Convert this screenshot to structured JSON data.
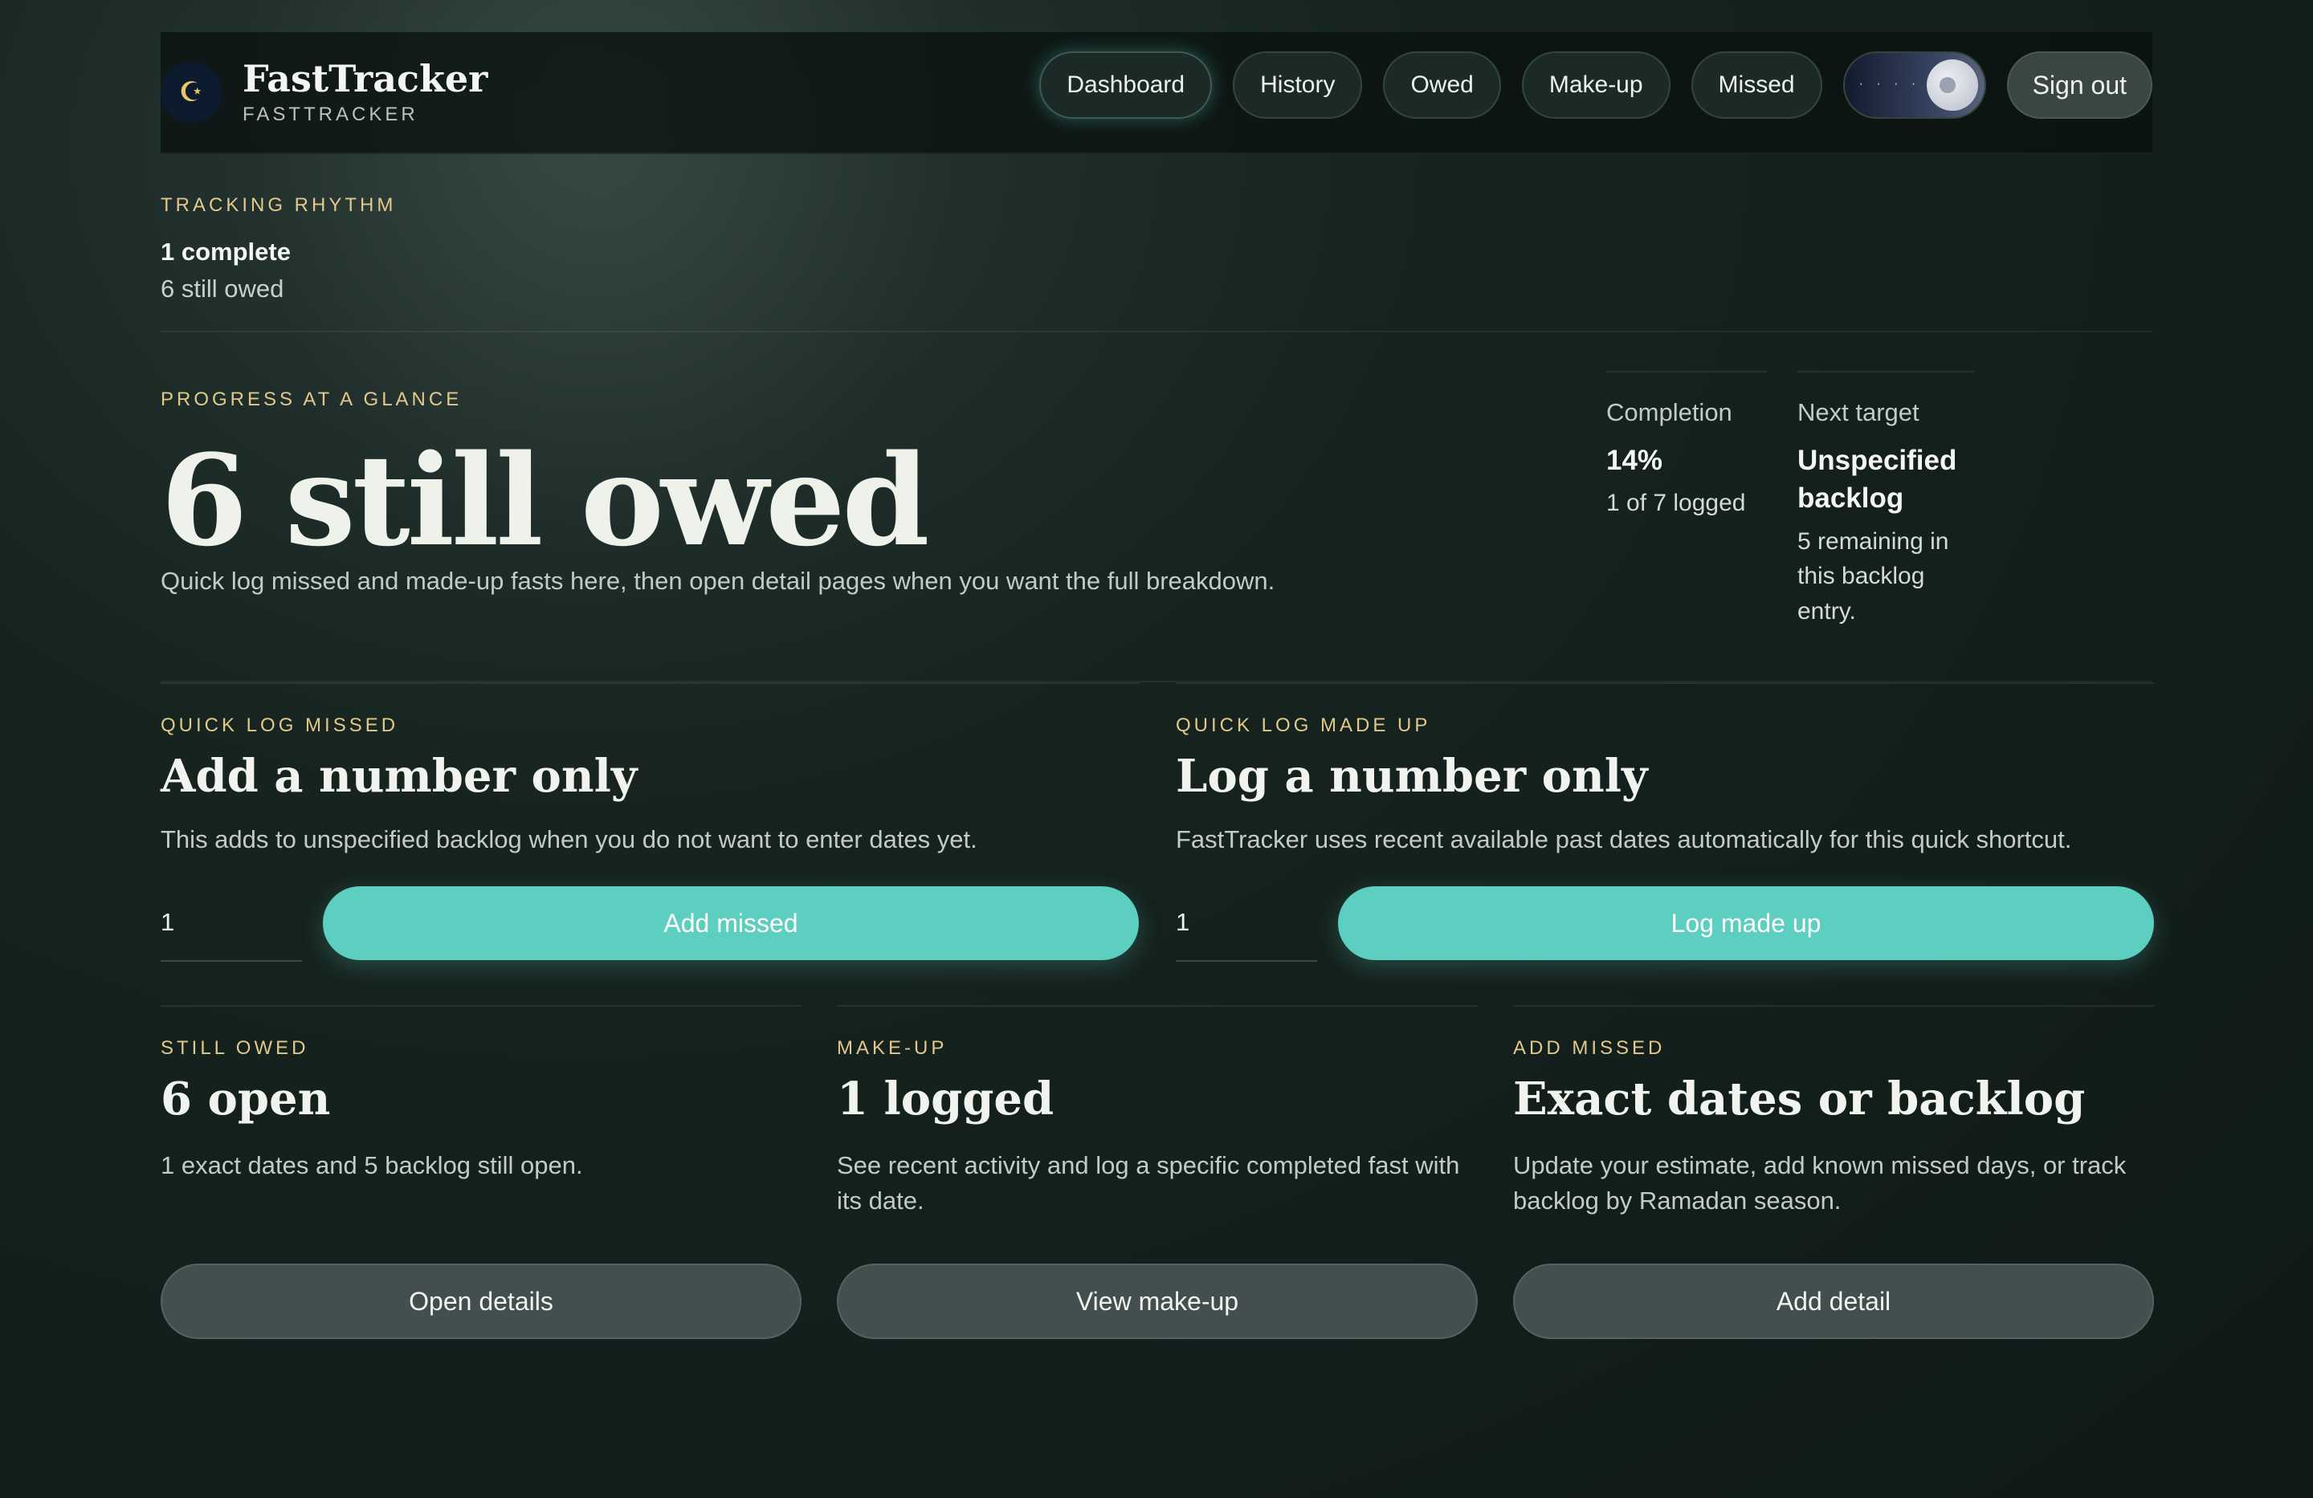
{
  "app": {
    "brand_name": "FastTracker",
    "brand_sub": "FASTTRACKER",
    "logo_glyph": "☪"
  },
  "nav": {
    "items": [
      {
        "label": "Dashboard",
        "active": true
      },
      {
        "label": "History"
      },
      {
        "label": "Owed"
      },
      {
        "label": "Make-up"
      },
      {
        "label": "Missed"
      }
    ],
    "theme_toggle_stars": "· · · · ·",
    "sign_out": "Sign out"
  },
  "rhythm": {
    "eyebrow": "TRACKING RHYTHM",
    "complete": "1 complete",
    "owed": "6 still owed"
  },
  "progress": {
    "eyebrow": "PROGRESS AT A GLANCE",
    "title": "6 still owed",
    "description": "Quick log missed and made-up fasts here, then open detail pages when you want the full breakdown.",
    "completion": {
      "label": "Completion",
      "value": "14%",
      "sub": "1 of 7 logged"
    },
    "next_target": {
      "label": "Next target",
      "value": "Unspecified backlog",
      "sub": "5 remaining in this backlog entry."
    }
  },
  "quick_missed": {
    "eyebrow": "QUICK LOG MISSED",
    "title": "Add a number only",
    "description": "This adds to unspecified backlog when you do not want to enter dates yet.",
    "input_value": "1",
    "button": "Add missed"
  },
  "quick_madeup": {
    "eyebrow": "QUICK LOG MADE UP",
    "title": "Log a number only",
    "description": "FastTracker uses recent available past dates automatically for this quick shortcut.",
    "input_value": "1",
    "button": "Log made up"
  },
  "cards": [
    {
      "eyebrow": "STILL OWED",
      "title": "6 open",
      "description": "1 exact dates and 5 backlog still open.",
      "button": "Open details"
    },
    {
      "eyebrow": "MAKE-UP",
      "title": "1 logged",
      "description": "See recent activity and log a specific completed fast with its date.",
      "button": "View make-up"
    },
    {
      "eyebrow": "ADD MISSED",
      "title": "Exact dates or backlog",
      "description": "Update your estimate, add known missed days, or track backlog by Ramadan season.",
      "button": "Add detail"
    }
  ],
  "colors": {
    "accent": "#5ccfc1",
    "eyebrow": "#e2c98a",
    "background": "#16231f"
  }
}
